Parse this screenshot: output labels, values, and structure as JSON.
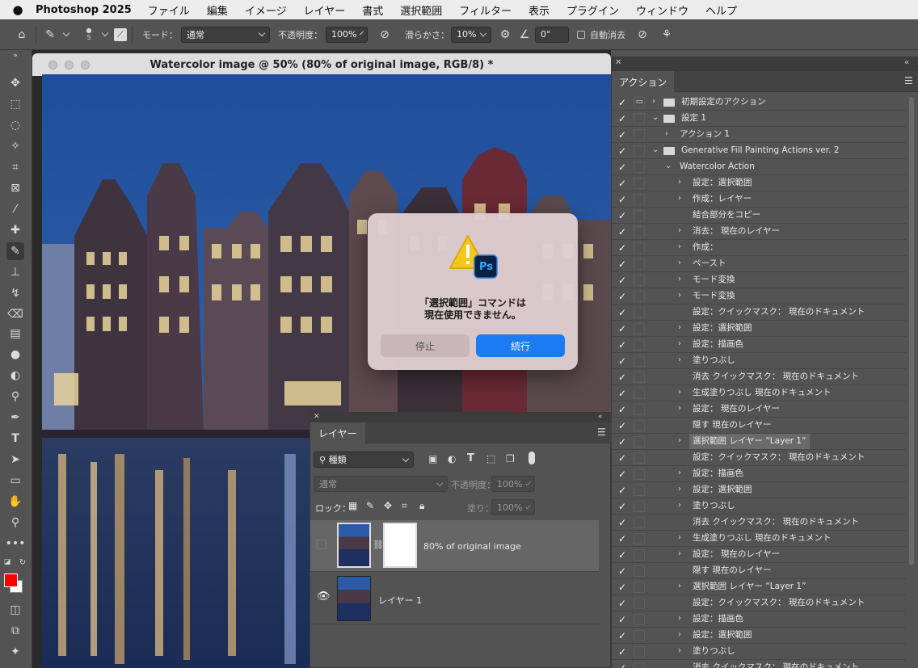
{
  "menubar": {
    "app_name": "Photoshop 2025",
    "items": [
      "ファイル",
      "編集",
      "イメージ",
      "レイヤー",
      "書式",
      "選択範囲",
      "フィルター",
      "表示",
      "プラグイン",
      "ウィンドウ",
      "ヘルプ"
    ]
  },
  "options": {
    "brush_size": "5",
    "mode_label": "モード：",
    "mode_value": "通常",
    "opacity_label": "不透明度：",
    "opacity_value": "100%",
    "smoothing_label": "滑らかさ：",
    "smoothing_value": "10%",
    "angle_value": "0°",
    "auto_erase_label": "自動消去"
  },
  "document": {
    "title": "Watercolor image @ 50% (80% of original image, RGB/8) *"
  },
  "dialog": {
    "message_line1": "「選択範囲」コマンドは",
    "message_line2": "現在使用できません。",
    "stop_label": "停止",
    "continue_label": "続行",
    "app_badge": "Ps"
  },
  "layers_panel": {
    "tab_label": "レイヤー",
    "filter_kind": "種類",
    "blend_mode": "通常",
    "opacity_label": "不透明度：",
    "opacity_value": "100%",
    "lock_label": "ロック：",
    "fill_label": "塗り：",
    "fill_value": "100%",
    "layers": [
      {
        "name": "80% of original image",
        "visible": false,
        "has_mask": true
      },
      {
        "name": "レイヤー 1",
        "visible": true,
        "has_mask": false
      }
    ]
  },
  "actions_panel": {
    "tab_label": "アクション",
    "rows": [
      {
        "label": "初期設定のアクション",
        "indent": 0,
        "type": "set",
        "expanded": false,
        "selected": false
      },
      {
        "label": "設定 1",
        "indent": 0,
        "type": "set",
        "expanded": true,
        "selected": false
      },
      {
        "label": "アクション 1",
        "indent": 1,
        "type": "action",
        "expanded": false,
        "selected": false
      },
      {
        "label": "Generative Fill Painting Actions ver. 2",
        "indent": 0,
        "type": "set",
        "expanded": true,
        "selected": false
      },
      {
        "label": "Watercolor Action",
        "indent": 1,
        "type": "action",
        "expanded": true,
        "selected": false
      },
      {
        "label": "設定：選択範囲",
        "indent": 2,
        "type": "cmd",
        "expandable": true,
        "selected": false
      },
      {
        "label": "作成：レイヤー",
        "indent": 2,
        "type": "cmd",
        "expandable": true,
        "selected": false
      },
      {
        "label": "結合部分をコピー",
        "indent": 2,
        "type": "cmd",
        "expandable": false,
        "selected": false
      },
      {
        "label": "消去： 現在のレイヤー",
        "indent": 2,
        "type": "cmd",
        "expandable": true,
        "selected": false
      },
      {
        "label": "作成：",
        "indent": 2,
        "type": "cmd",
        "expandable": true,
        "selected": false
      },
      {
        "label": "ペースト",
        "indent": 2,
        "type": "cmd",
        "expandable": true,
        "selected": false
      },
      {
        "label": "モード変換",
        "indent": 2,
        "type": "cmd",
        "expandable": true,
        "selected": false
      },
      {
        "label": "モード変換",
        "indent": 2,
        "type": "cmd",
        "expandable": true,
        "selected": false
      },
      {
        "label": "設定：クイックマスク： 現在のドキュメント",
        "indent": 2,
        "type": "cmd",
        "expandable": false,
        "selected": false
      },
      {
        "label": "設定：選択範囲",
        "indent": 2,
        "type": "cmd",
        "expandable": true,
        "selected": false
      },
      {
        "label": "設定：描画色",
        "indent": 2,
        "type": "cmd",
        "expandable": true,
        "selected": false
      },
      {
        "label": "塗りつぶし",
        "indent": 2,
        "type": "cmd",
        "expandable": true,
        "selected": false
      },
      {
        "label": "消去 クイックマスク： 現在のドキュメント",
        "indent": 2,
        "type": "cmd",
        "expandable": false,
        "selected": false
      },
      {
        "label": "生成塗りつぶし 現在のドキュメント",
        "indent": 2,
        "type": "cmd",
        "expandable": true,
        "selected": false
      },
      {
        "label": "設定： 現在のレイヤー",
        "indent": 2,
        "type": "cmd",
        "expandable": true,
        "selected": false
      },
      {
        "label": "隠す 現在のレイヤー",
        "indent": 2,
        "type": "cmd",
        "expandable": false,
        "selected": false
      },
      {
        "label": "選択範囲 レイヤー “Layer 1”",
        "indent": 2,
        "type": "cmd",
        "expandable": true,
        "selected": true
      },
      {
        "label": "設定：クイックマスク： 現在のドキュメント",
        "indent": 2,
        "type": "cmd",
        "expandable": false,
        "selected": false
      },
      {
        "label": "設定：描画色",
        "indent": 2,
        "type": "cmd",
        "expandable": true,
        "selected": false
      },
      {
        "label": "設定：選択範囲",
        "indent": 2,
        "type": "cmd",
        "expandable": true,
        "selected": false
      },
      {
        "label": "塗りつぶし",
        "indent": 2,
        "type": "cmd",
        "expandable": true,
        "selected": false
      },
      {
        "label": "消去 クイックマスク： 現在のドキュメント",
        "indent": 2,
        "type": "cmd",
        "expandable": false,
        "selected": false
      },
      {
        "label": "生成塗りつぶし 現在のドキュメント",
        "indent": 2,
        "type": "cmd",
        "expandable": true,
        "selected": false
      },
      {
        "label": "設定： 現在のレイヤー",
        "indent": 2,
        "type": "cmd",
        "expandable": true,
        "selected": false
      },
      {
        "label": "隠す 現在のレイヤー",
        "indent": 2,
        "type": "cmd",
        "expandable": false,
        "selected": false
      },
      {
        "label": "選択範囲 レイヤー “Layer 1”",
        "indent": 2,
        "type": "cmd",
        "expandable": true,
        "selected": false
      },
      {
        "label": "設定：クイックマスク： 現在のドキュメント",
        "indent": 2,
        "type": "cmd",
        "expandable": false,
        "selected": false
      },
      {
        "label": "設定：描画色",
        "indent": 2,
        "type": "cmd",
        "expandable": true,
        "selected": false
      },
      {
        "label": "設定：選択範囲",
        "indent": 2,
        "type": "cmd",
        "expandable": true,
        "selected": false
      },
      {
        "label": "塗りつぶし",
        "indent": 2,
        "type": "cmd",
        "expandable": true,
        "selected": false
      },
      {
        "label": "消去 クイックマスク： 現在のドキュメント",
        "indent": 2,
        "type": "cmd",
        "expandable": false,
        "selected": false
      }
    ]
  },
  "colors": {
    "foreground": "#ff0000",
    "background": "#ffffff",
    "accent": "#1a7bf2"
  }
}
